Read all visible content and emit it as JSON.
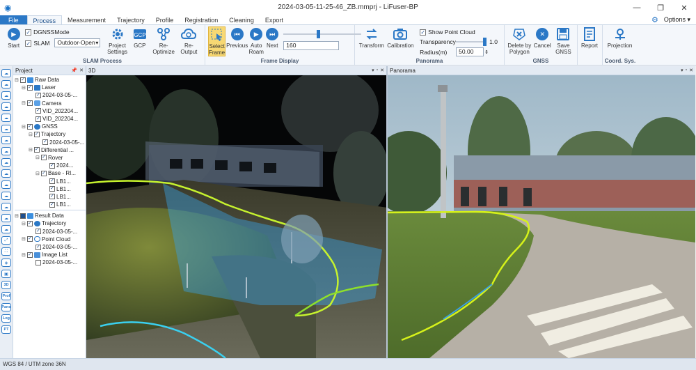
{
  "window": {
    "title": "2024-03-05-11-25-46_ZB.mmprj - LiFuser-BP",
    "minimize": "—",
    "restore": "❐",
    "close": "✕"
  },
  "menu": {
    "tabs": [
      "File",
      "Process",
      "Measurement",
      "Trajectory",
      "Profile",
      "Registration",
      "Cleaning",
      "Export"
    ],
    "active_tab": "Process",
    "options_label": "Options",
    "options_arrow": "▾"
  },
  "ribbon": {
    "slam_process": {
      "label": "SLAM Process",
      "start_label": "Start",
      "dgnss_label": "DGNSS",
      "slam_label": "SLAM",
      "mode_label": "Mode",
      "mode_value": "Outdoor-Open",
      "project_settings_label": "Project Settings",
      "gcp_label": "GCP",
      "reoptimize_label": "Re-Optimize",
      "reoutput_label": "Re-Output"
    },
    "frame_display": {
      "label": "Frame Display",
      "select_frame_label": "Select Frame",
      "previous_label": "Previous",
      "auto_roam_label": "Auto Roam",
      "next_label": "Next",
      "frame_value": "160",
      "frame_slider_fraction": 0.45
    },
    "panorama": {
      "label": "Panorama",
      "transform_label": "Transform",
      "calibration_label": "Calibration",
      "show_point_cloud_label": "Show Point Cloud",
      "transparency_label": "Transparency",
      "transparency_value": "1.0",
      "transparency_fraction": 1.0,
      "radius_label": "Radius(m)",
      "radius_value": "50.00"
    },
    "gnss": {
      "label": "GNSS",
      "delete_by_polygon_label": "Delete by Polygon",
      "cancel_label": "Cancel",
      "save_gnss_label": "Save GNSS"
    },
    "report_label": "Report",
    "coord_sys": {
      "label": "Coord. Sys.",
      "projection_label": "Projection"
    }
  },
  "left_tools": {
    "text_items": [
      "3D",
      "Prof",
      "Pano",
      "Log",
      "PT"
    ]
  },
  "project_panel": {
    "title": "Project",
    "raw_data_label": "Raw Data",
    "laser_label": "Laser",
    "laser_file": "2024-03-05-...",
    "camera_label": "Camera",
    "video_files": [
      "VID_202204...",
      "VID_202204..."
    ],
    "gnss_label": "GNSS",
    "trajectory_label": "Trajectory",
    "trajectory_file": "2024-03-05-...",
    "differential_label": "Differential ...",
    "rover_label": "Rover",
    "rover_file": "2024...",
    "base_label": "Base - RI...",
    "base_files": [
      "LB1...",
      "LB1...",
      "LB1...",
      "LB1..."
    ],
    "result_data_label": "Result Data",
    "result_trajectory_label": "Trajectory",
    "result_trajectory_file": "2024-03-05-...",
    "point_cloud_label": "Point Cloud",
    "point_cloud_file": "2024-03-05-...",
    "image_list_label": "Image List",
    "image_list_file": "2024-03-05-..."
  },
  "views": {
    "view3d_title": "3D",
    "panorama_title": "Panorama",
    "pin": "▾",
    "float": "▫",
    "close": "✕"
  },
  "status": {
    "coord_system": "WGS 84 / UTM zone 36N"
  },
  "colors": {
    "accent": "#2b78c6",
    "trajectory": "#c6f22e",
    "selection_overlay": "#3aa0e0"
  }
}
